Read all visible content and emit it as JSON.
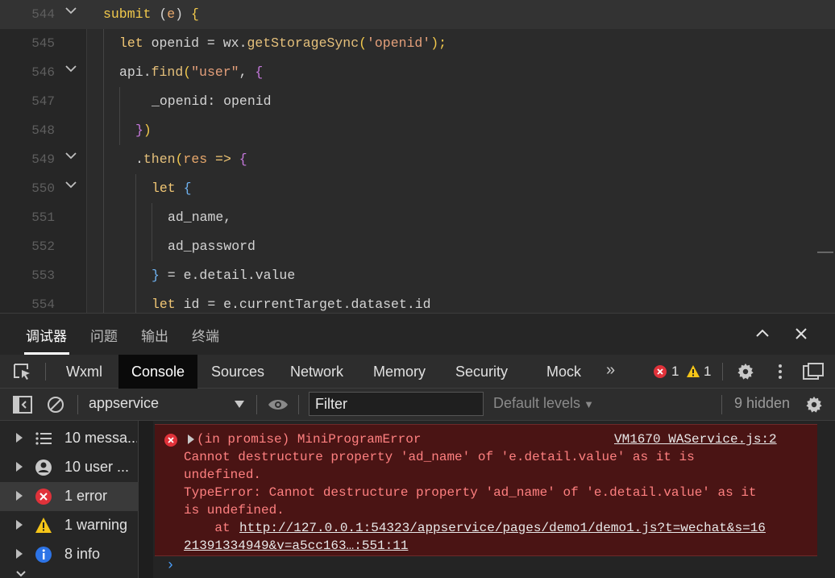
{
  "editor": {
    "lines": [
      {
        "num": "544",
        "fold": true
      },
      {
        "num": "545",
        "fold": false
      },
      {
        "num": "546",
        "fold": true
      },
      {
        "num": "547",
        "fold": false
      },
      {
        "num": "548",
        "fold": false
      },
      {
        "num": "549",
        "fold": true
      },
      {
        "num": "550",
        "fold": true
      },
      {
        "num": "551",
        "fold": false
      },
      {
        "num": "552",
        "fold": false
      },
      {
        "num": "553",
        "fold": false
      },
      {
        "num": "554",
        "fold": false
      }
    ],
    "code": {
      "l544": {
        "name": "submit",
        "open": " (",
        "param": "e",
        "close": ") ",
        "brace": "{"
      },
      "l545": {
        "kw": "let",
        "var": " openid = ",
        "obj": "wx",
        "dot": ".",
        "fn": "getStorageSync",
        "p1": "(",
        "str": "'openid'",
        "p2": ");"
      },
      "l546": {
        "obj": "api",
        "dot": ".",
        "fn": "find",
        "p1": "(",
        "str": "\"user\"",
        "comma": ", ",
        "brace": "{"
      },
      "l547": {
        "key": "_openid",
        "colon": ": ",
        "val": "openid"
      },
      "l548": {
        "brace": "}",
        "paren": ")"
      },
      "l549": {
        "dot": ".",
        "fn": "then",
        "p1": "(",
        "param": "res",
        "arrow": " => ",
        "brace": "{"
      },
      "l550": {
        "kw": "let",
        "brace": " {"
      },
      "l551": {
        "text": "ad_name,"
      },
      "l552": {
        "text": "ad_password"
      },
      "l553": {
        "brace": "}",
        "rest": " = e.detail.value"
      },
      "l554": {
        "kw": "let",
        "rest": " id = e.currentTarget.dataset.id"
      }
    }
  },
  "debugger": {
    "tabs": [
      "调试器",
      "问题",
      "输出",
      "终端"
    ],
    "active_tab": "调试器"
  },
  "devtools": {
    "tabs": [
      "Wxml",
      "Console",
      "Sources",
      "Network",
      "Memory",
      "Security",
      "Mock"
    ],
    "active_tab": "Console",
    "error_count": "1",
    "warning_count": "1"
  },
  "toolbar": {
    "context": "appservice",
    "filter_value": "Filter",
    "levels": "Default levels",
    "hidden": "9 hidden"
  },
  "sidebar": {
    "items": [
      {
        "label": "10 messa...",
        "icon": "list-icon"
      },
      {
        "label": "10 user ...",
        "icon": "user-icon"
      },
      {
        "label": "1 error",
        "icon": "error-icon"
      },
      {
        "label": "1 warning",
        "icon": "warning-icon"
      },
      {
        "label": "8 info",
        "icon": "info-icon"
      }
    ]
  },
  "console": {
    "error": {
      "summary": "(in promise) MiniProgramError",
      "source": "VM1670 WAService.js:2",
      "line1": "Cannot destructure property 'ad_name' of 'e.detail.value' as it is",
      "line2": "undefined.",
      "line3": "TypeError: Cannot destructure property 'ad_name' of 'e.detail.value' as it",
      "line4": "is undefined.",
      "at_prefix": "    at ",
      "url1": "http://127.0.0.1:54323/appservice/pages/demo1/demo1.js?t=wechat&s=16",
      "url2": "21391334949&v=a5cc163…:551:11"
    },
    "prompt": "›"
  },
  "colors": {
    "accent_error": "#e0323a",
    "accent_warning": "#f5c518",
    "accent_info": "#2d74e6"
  }
}
